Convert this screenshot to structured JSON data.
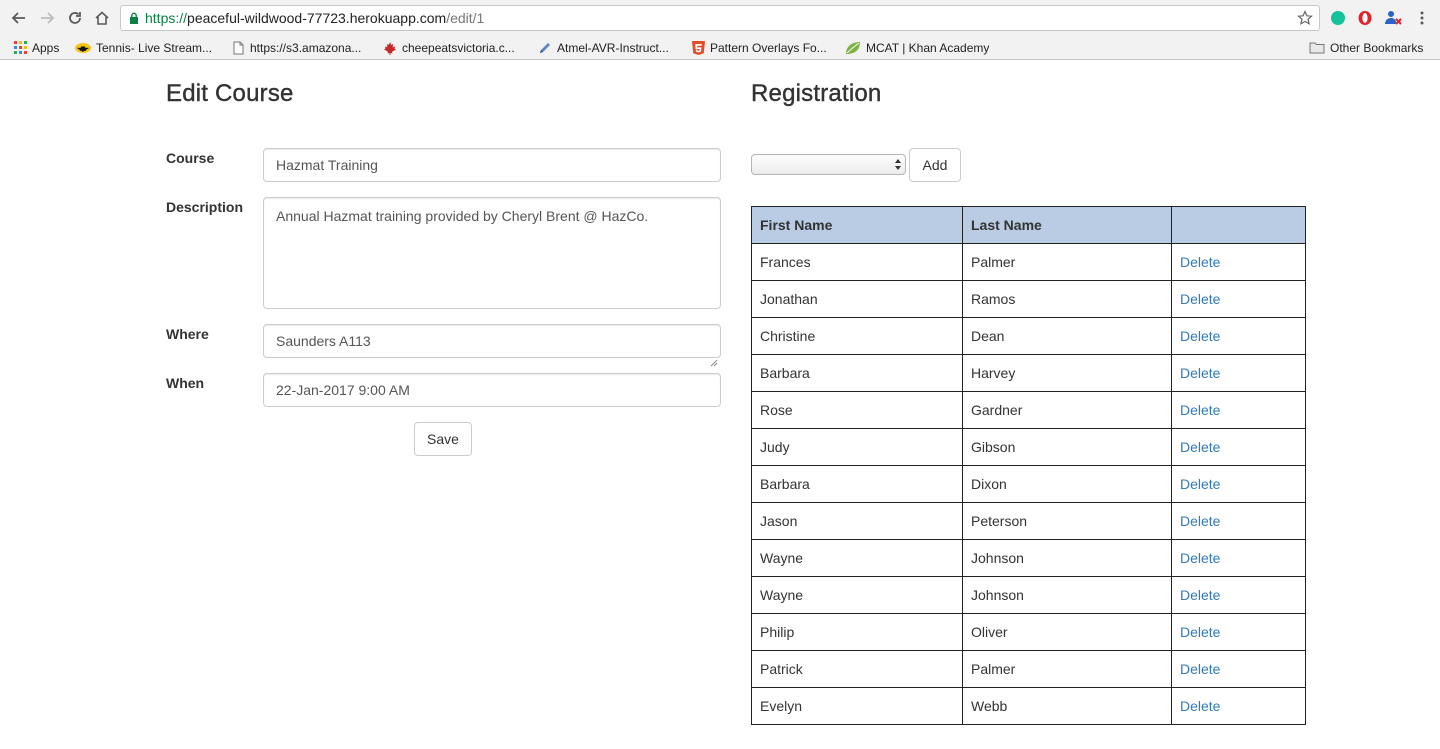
{
  "browser": {
    "url_scheme": "https://",
    "url_host": "peaceful-wildwood-77723.herokuapp.com",
    "url_path": "/edit/1",
    "bookmarks": [
      {
        "label": "Apps",
        "icon": "apps-grid-icon"
      },
      {
        "label": "Tennis- Live Stream...",
        "icon": "batman-icon"
      },
      {
        "label": "https://s3.amazona...",
        "icon": "page-icon"
      },
      {
        "label": "cheepeatsvictoria.c...",
        "icon": "maple-leaf-icon"
      },
      {
        "label": "Atmel-AVR-Instruct...",
        "icon": "pen-icon"
      },
      {
        "label": "Pattern Overlays Fo...",
        "icon": "html5-icon"
      },
      {
        "label": "MCAT | Khan Academy",
        "icon": "khan-leaf-icon"
      }
    ],
    "other_bookmarks": "Other Bookmarks"
  },
  "edit": {
    "title": "Edit Course",
    "course_label": "Course",
    "course_value": "Hazmat Training",
    "description_label": "Description",
    "description_value": "Annual Hazmat training provided by Cheryl Brent @ HazCo.",
    "where_label": "Where",
    "where_value": "Saunders A113",
    "when_label": "When",
    "when_value": "22-Jan-2017 9:00 AM",
    "save_label": "Save"
  },
  "registration": {
    "title": "Registration",
    "select_value": "",
    "add_label": "Add",
    "headers": [
      "First Name",
      "Last Name",
      ""
    ],
    "delete_label": "Delete",
    "rows": [
      {
        "first": "Frances",
        "last": "Palmer"
      },
      {
        "first": "Jonathan",
        "last": "Ramos"
      },
      {
        "first": "Christine",
        "last": "Dean"
      },
      {
        "first": "Barbara",
        "last": "Harvey"
      },
      {
        "first": "Rose",
        "last": "Gardner"
      },
      {
        "first": "Judy",
        "last": "Gibson"
      },
      {
        "first": "Barbara",
        "last": "Dixon"
      },
      {
        "first": "Jason",
        "last": "Peterson"
      },
      {
        "first": "Wayne",
        "last": "Johnson"
      },
      {
        "first": "Wayne",
        "last": "Johnson"
      },
      {
        "first": "Philip",
        "last": "Oliver"
      },
      {
        "first": "Patrick",
        "last": "Palmer"
      },
      {
        "first": "Evelyn",
        "last": "Webb"
      }
    ]
  },
  "colors": {
    "table_header_bg": "#b9cce4",
    "link": "#337ab7",
    "secure_green": "#0b8043"
  }
}
